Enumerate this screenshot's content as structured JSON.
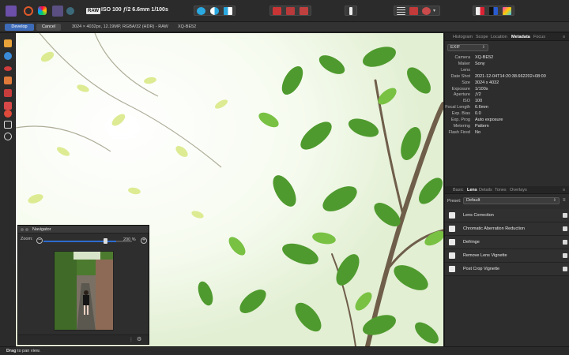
{
  "toolbar": {
    "raw_badge": "RAW",
    "shot_info": "ISO 100 ƒ/2 6.6mm 1/100s"
  },
  "context": {
    "develop_label": "Develop",
    "cancel_label": "Cancel",
    "image_info": "3024 × 4032px, 12.19MP, RGBA/32 (HDR) - RAW",
    "camera": "XQ-BE52"
  },
  "navigator": {
    "title": "Navigator",
    "zoom_label": "Zoom:",
    "zoom_value": "200 %",
    "zoom_level": 0.82
  },
  "panel": {
    "tabs": [
      "Histogram",
      "Scope",
      "Location",
      "Metadata",
      "Focus"
    ],
    "active_tab": "Metadata",
    "exif_select": "EXIF",
    "metadata": [
      {
        "key": "Camera",
        "value": "XQ-BE52"
      },
      {
        "key": "Maker",
        "value": "Sony"
      },
      {
        "key": "Lens",
        "value": ""
      },
      {
        "key": "Date Shot",
        "value": "2021-12-04T14:20:38.662202+08:00"
      },
      {
        "key": "Size",
        "value": "3024 x 4032"
      },
      {
        "key": "Exposure",
        "value": "1/100s"
      },
      {
        "key": "Aperture",
        "value": "ƒ/2"
      },
      {
        "key": "ISO",
        "value": "100"
      },
      {
        "key": "Focal Length",
        "value": "6.6mm"
      },
      {
        "key": "Exp. Bias",
        "value": "0.0"
      },
      {
        "key": "Exp. Prog",
        "value": "Auto exposure"
      },
      {
        "key": "Metering",
        "value": "Pattern"
      },
      {
        "key": "Flash Fired",
        "value": "No"
      }
    ],
    "lower_tabs": [
      "Basic",
      "Lens",
      "Details",
      "Tones",
      "Overlays"
    ],
    "lower_active": "Lens",
    "preset_label": "Preset:",
    "preset_value": "Default",
    "lens_items": [
      "Lens Correction",
      "Chromatic Aberration Reduction",
      "Defringe",
      "Remove Lens Vignette",
      "Post Crop Vignette"
    ]
  },
  "status": {
    "bold": "Drag",
    "rest": " to pan view."
  }
}
